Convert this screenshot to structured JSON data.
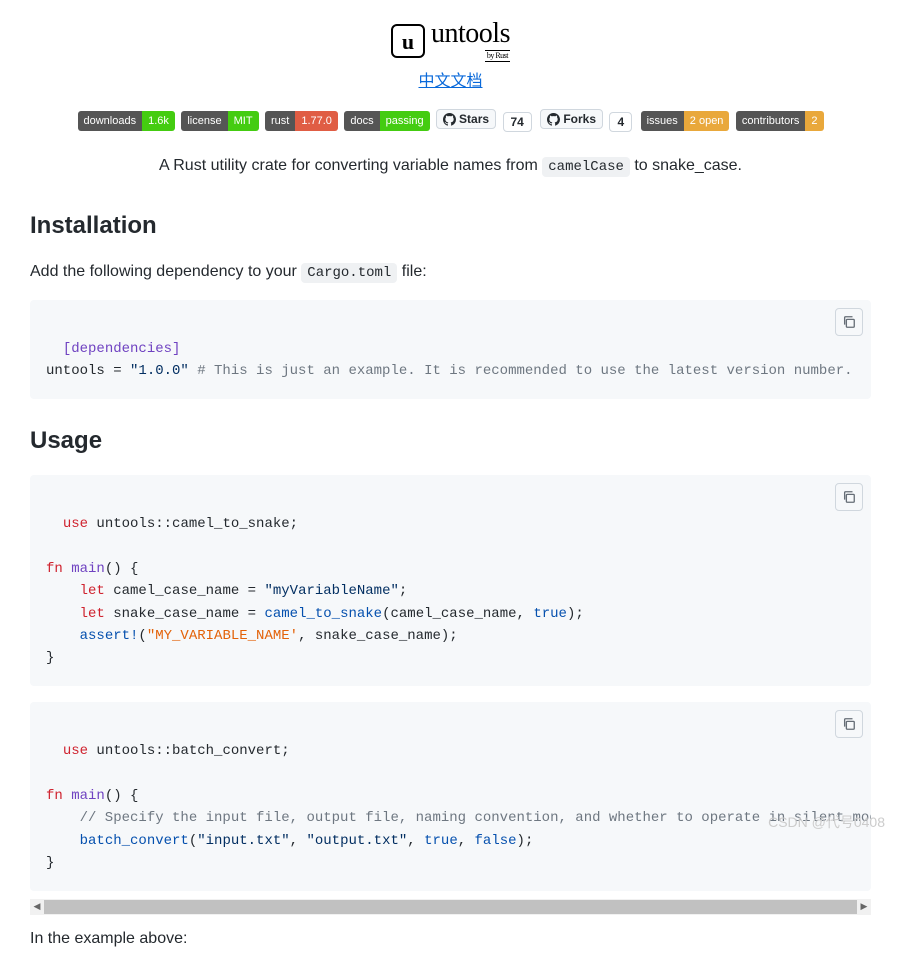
{
  "logo": {
    "icon_letter": "u",
    "name": "untools",
    "subtitle": "by Rust"
  },
  "chinese_link": "中文文档",
  "badges": {
    "downloads": {
      "label": "downloads",
      "value": "1.6k"
    },
    "license": {
      "label": "license",
      "value": "MIT"
    },
    "rust": {
      "label": "rust",
      "value": "1.77.0"
    },
    "docs": {
      "label": "docs",
      "value": "passing"
    },
    "stars": {
      "label": "Stars",
      "count": "74"
    },
    "forks": {
      "label": "Forks",
      "count": "4"
    },
    "issues": {
      "label": "issues",
      "value": "2 open"
    },
    "contributors": {
      "label": "contributors",
      "value": "2"
    }
  },
  "tagline": {
    "pre": "A Rust utility crate for converting variable names from ",
    "code": "camelCase",
    "post": " to snake_case."
  },
  "installation": {
    "heading": "Installation",
    "desc_pre": "Add the following dependency to your ",
    "desc_code": "Cargo.toml",
    "desc_post": " file:",
    "code": {
      "l1": "[dependencies]",
      "l2a": "untools = ",
      "l2b": "\"1.0.0\"",
      "l2c": " # This is just an example. It is recommended to use the latest version number."
    }
  },
  "usage": {
    "heading": "Usage",
    "block1": {
      "l1a": "use",
      "l1b": " untools::camel_to_snake;",
      "l3a": "fn",
      "l3b": " ",
      "l3c": "main",
      "l3d": "() {",
      "l4a": "    ",
      "l4b": "let",
      "l4c": " camel_case_name = ",
      "l4d": "\"myVariableName\"",
      "l4e": ";",
      "l5a": "    ",
      "l5b": "let",
      "l5c": " snake_case_name = ",
      "l5d": "camel_to_snake",
      "l5e": "(camel_case_name, ",
      "l5f": "true",
      "l5g": ");",
      "l6a": "    ",
      "l6b": "assert!",
      "l6c": "(",
      "l6d": "\"MY_VARIABLE_NAME'",
      "l6e": ", snake_case_name);",
      "l7": "}"
    },
    "block2": {
      "l1a": "use",
      "l1b": " untools::batch_convert;",
      "l3a": "fn",
      "l3b": " ",
      "l3c": "main",
      "l3d": "() {",
      "l4": "    // Specify the input file, output file, naming convention, and whether to operate in silent mode.",
      "l5a": "    ",
      "l5b": "batch_convert",
      "l5c": "(",
      "l5d": "\"input.txt\"",
      "l5e": ", ",
      "l5f": "\"output.txt\"",
      "l5g": ", ",
      "l5h": "true",
      "l5i": ", ",
      "l5j": "false",
      "l5k": ");",
      "l6": "}"
    }
  },
  "footer_line": "In the example above:",
  "watermark": "CSDN @代号0408"
}
